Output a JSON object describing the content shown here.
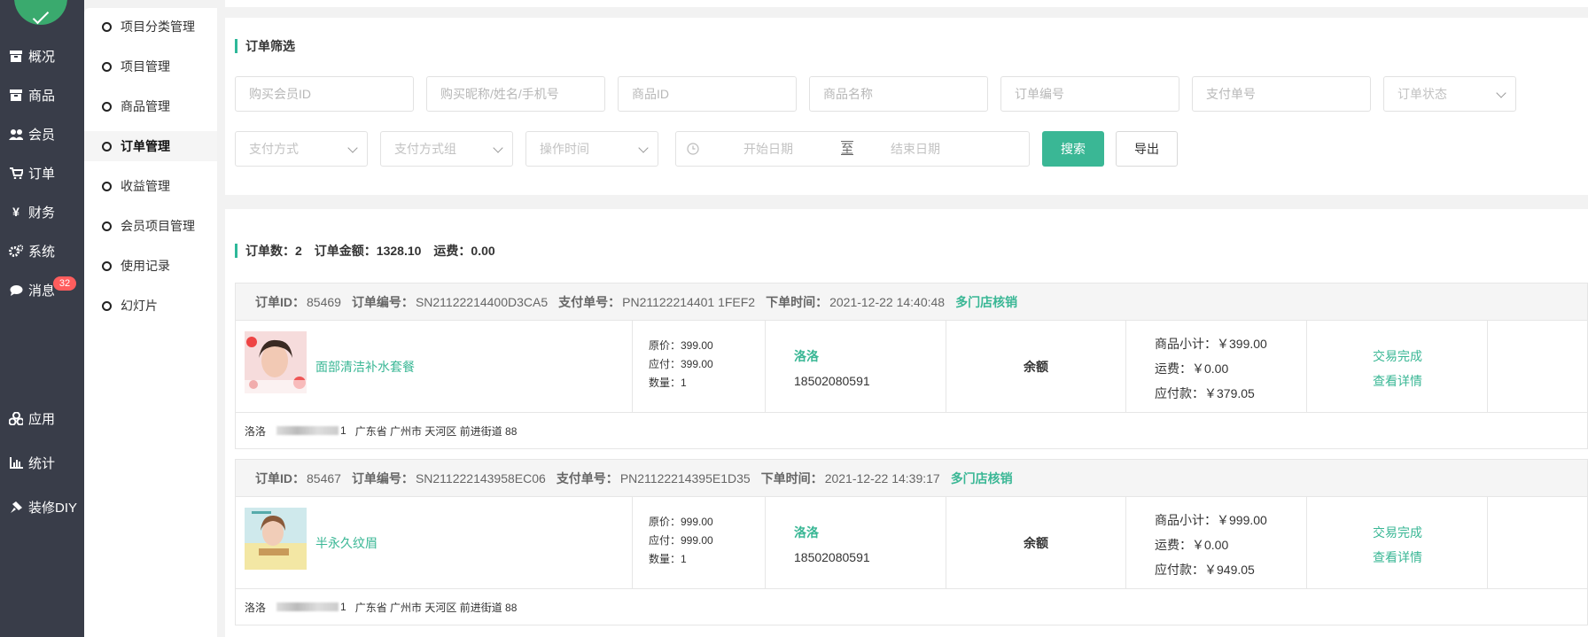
{
  "nav": {
    "items": [
      {
        "label": "概况",
        "icon": "overview-icon"
      },
      {
        "label": "商品",
        "icon": "goods-icon"
      },
      {
        "label": "会员",
        "icon": "members-icon"
      },
      {
        "label": "订单",
        "icon": "cart-icon"
      },
      {
        "label": "财务",
        "icon": "yen-icon"
      },
      {
        "label": "系统",
        "icon": "gears-icon"
      },
      {
        "label": "消息",
        "icon": "chat-icon",
        "badge": "32"
      },
      {
        "label": "应用",
        "icon": "apps-icon"
      },
      {
        "label": "统计",
        "icon": "chart-icon"
      },
      {
        "label": "装修DIY",
        "icon": "paint-icon"
      }
    ]
  },
  "subnav": {
    "items": [
      "项目分类管理",
      "项目管理",
      "商品管理",
      "订单管理",
      "收益管理",
      "会员项目管理",
      "使用记录",
      "幻灯片"
    ],
    "active": "订单管理"
  },
  "filter": {
    "title": "订单筛选",
    "fields": {
      "member_id": "购买会员ID",
      "nickname": "购买昵称/姓名/手机号",
      "goods_id": "商品ID",
      "goods_name": "商品名称",
      "order_no": "订单编号",
      "pay_no": "支付单号",
      "order_status": "订单状态",
      "pay_method": "支付方式",
      "pay_group": "支付方式组",
      "op_time": "操作时间",
      "start_date": "开始日期",
      "date_sep": "至",
      "end_date": "结束日期"
    },
    "search_label": "搜索",
    "export_label": "导出"
  },
  "summary": {
    "count": "订单数：2",
    "amount": "订单金额：1328.10",
    "freight": "运费：0.00"
  },
  "orders": [
    {
      "id_label": "订单ID：",
      "id": "85469",
      "no_label": "订单编号：",
      "no": "SN21122214400D3CA5",
      "pay_label": "支付单号：",
      "pay": "PN21122214401 1FEF2",
      "time_label": "下单时间：",
      "time": "2021-12-22 14:40:48",
      "tag": "多门店核销",
      "product": "面部清洁补水套餐",
      "orig": "原价：399.00",
      "due": "应付：399.00",
      "qty": "数量：1",
      "buyer": "洛洛",
      "phone": "18502080591",
      "pay_type": "余额",
      "subtotal": "商品小计：￥399.00",
      "freight": "运费：￥0.00",
      "payable": "应付款：￥379.05",
      "status": "交易完成",
      "detail": "查看详情",
      "addr_name": "洛洛",
      "addr_tail": "1",
      "addr": "广东省 广州市 天河区 前进街道 88"
    },
    {
      "id_label": "订单ID：",
      "id": "85467",
      "no_label": "订单编号：",
      "no": "SN211222143958EC06",
      "pay_label": "支付单号：",
      "pay": "PN21122214395E1D35",
      "time_label": "下单时间：",
      "time": "2021-12-22 14:39:17",
      "tag": "多门店核销",
      "product": "半永久纹眉",
      "orig": "原价：999.00",
      "due": "应付：999.00",
      "qty": "数量：1",
      "buyer": "洛洛",
      "phone": "18502080591",
      "pay_type": "余额",
      "subtotal": "商品小计：￥999.00",
      "freight": "运费：￥0.00",
      "payable": "应付款：￥949.05",
      "status": "交易完成",
      "detail": "查看详情",
      "addr_name": "洛洛",
      "addr_tail": "1",
      "addr": "广东省 广州市 天河区 前进街道 88"
    }
  ],
  "colors": {
    "accent": "#3ab795",
    "nav_bg": "#393d49",
    "badge": "#ff5d5d"
  }
}
